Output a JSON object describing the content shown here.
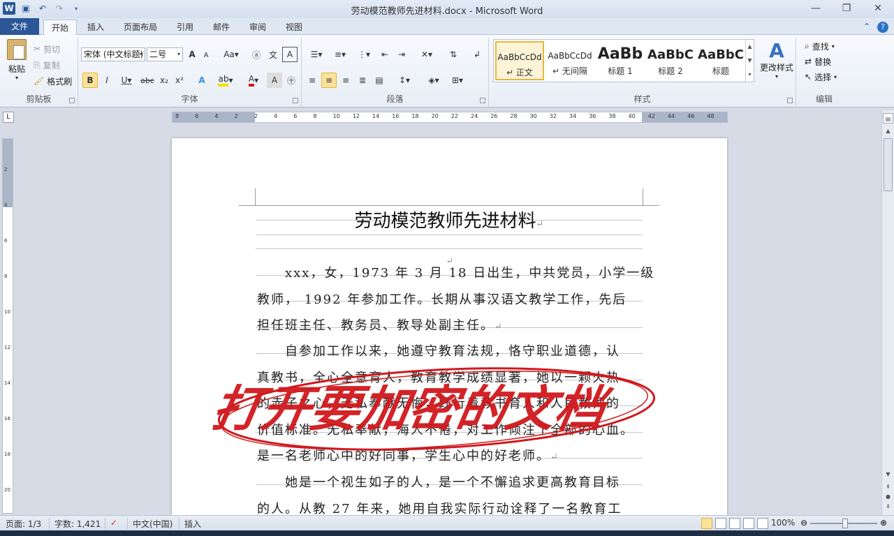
{
  "window": {
    "title": "劳动模范教师先进材料.docx - Microsoft Word"
  },
  "tabs": [
    "文件",
    "开始",
    "插入",
    "页面布局",
    "引用",
    "邮件",
    "审阅",
    "视图"
  ],
  "clipboard": {
    "paste": "粘贴",
    "cut": "剪切",
    "copy": "复制",
    "format_painter": "格式刷",
    "label": "剪贴板"
  },
  "font": {
    "name": "宋体 (中文标题)",
    "size": "二号",
    "label": "字体",
    "bold": "B",
    "italic": "I",
    "underline": "U",
    "strike": "abc",
    "sub": "x₂",
    "sup": "x²",
    "grow": "A",
    "shrink": "A",
    "case": "Aa"
  },
  "paragraph": {
    "label": "段落"
  },
  "styles": {
    "label": "样式",
    "items": [
      {
        "sample": "AaBbCcDd",
        "name": "↵ 正文"
      },
      {
        "sample": "AaBbCcDd",
        "name": "↵ 无间隔"
      },
      {
        "sample": "AaBb",
        "name": "标题 1"
      },
      {
        "sample": "AaBbC",
        "name": "标题 2"
      },
      {
        "sample": "AaBbC",
        "name": "标题"
      }
    ],
    "change_styles": "更改样式"
  },
  "editing": {
    "find": "查找",
    "replace": "替换",
    "select": "选择",
    "label": "编辑"
  },
  "ruler_ticks": [
    "8",
    "6",
    "4",
    "2",
    "2",
    "4",
    "6",
    "8",
    "10",
    "12",
    "14",
    "16",
    "18",
    "20",
    "22",
    "24",
    "26",
    "28",
    "30",
    "32",
    "34",
    "36",
    "38",
    "40",
    "42",
    "44",
    "46",
    "48"
  ],
  "vruler_ticks": [
    "2",
    "4",
    "6",
    "8",
    "10",
    "12",
    "14",
    "16",
    "18",
    "20"
  ],
  "document": {
    "title": "劳动模范教师先进材料",
    "p1": [
      "xxx，女，1973 年 3 月 18 日出生，中共党员，小学一级",
      "教师，  1992  年参加工作。长期从事汉语文教学工作，先后",
      "担任班主任、教务员、教导处副主任。"
    ],
    "p2": [
      "自参加工作以来，她遵守教育法规，恪守职业道德，认",
      "真教书，全心全意育人，教育教学成绩显著，她以一颗火热",
      "的赤子之心，无私奉献无悔，践行着教书育人和人民教师的",
      "价值标准。无私奉献，海人不倦，对工作倾注了全部的心血。",
      "是一名老师心中的好同事，学生心中的好老师。"
    ],
    "p3": [
      "她是一个视生如子的人，是一个不懈追求更高教育目标",
      "的人。从教  27  年来，她用自我实际行动诠释了一名教育工"
    ]
  },
  "overlay_text": "打开要加密的文档",
  "status": {
    "page": "页面: 1/3",
    "words": "字数: 1,421",
    "lang": "中文(中国)",
    "mode": "插入",
    "zoom": "100%"
  },
  "colors": {
    "accent": "#2b5797",
    "overlay": "#d0191d",
    "highlight": "#fbe29b"
  }
}
